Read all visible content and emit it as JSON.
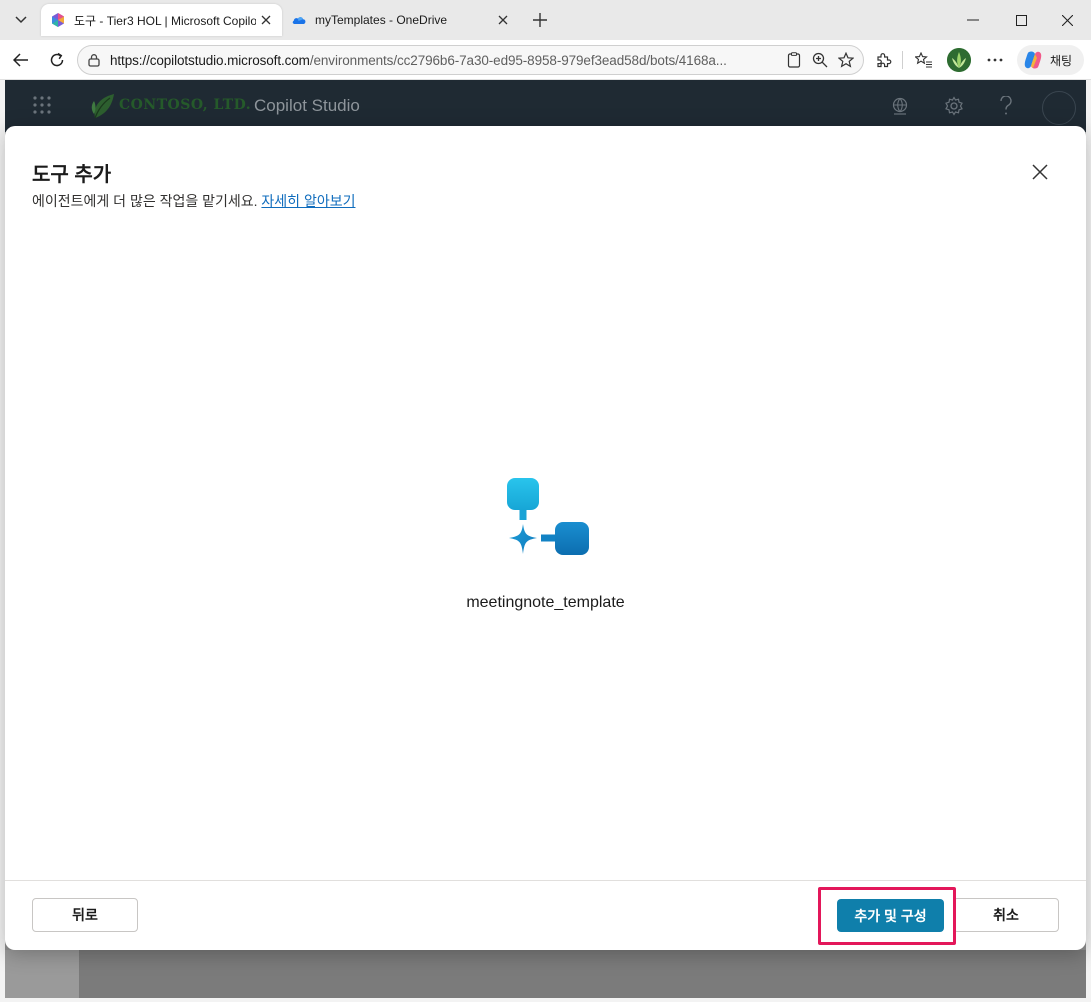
{
  "browser": {
    "tabs": [
      {
        "title": "도구 - Tier3 HOL | Microsoft Copilot Studio",
        "active": true,
        "icon": "copilot-studio-icon"
      },
      {
        "title": "myTemplates - OneDrive",
        "active": false,
        "icon": "onedrive-cloud-icon"
      }
    ],
    "url_host": "https://copilotstudio.microsoft.com",
    "url_path": "/environments/cc2796b6-7a30-ed95-8958-979ef3ead58d/bots/4168a...",
    "copilot_label": "채팅"
  },
  "app_header": {
    "company": "CONTOSO, LTD.",
    "app_name": "Copilot Studio"
  },
  "modal": {
    "title": "도구 추가",
    "subtitle": "에이전트에게 더 많은 작업을 맡기세요.",
    "learn_more": "자세히 알아보기",
    "tool_name": "meetingnote_template",
    "back_label": "뒤로",
    "primary_label": "추가 및 구성",
    "cancel_label": "취소"
  },
  "colors": {
    "primary": "#0f7fab",
    "highlight": "#e3175a",
    "header_bg": "#1f2a33"
  }
}
